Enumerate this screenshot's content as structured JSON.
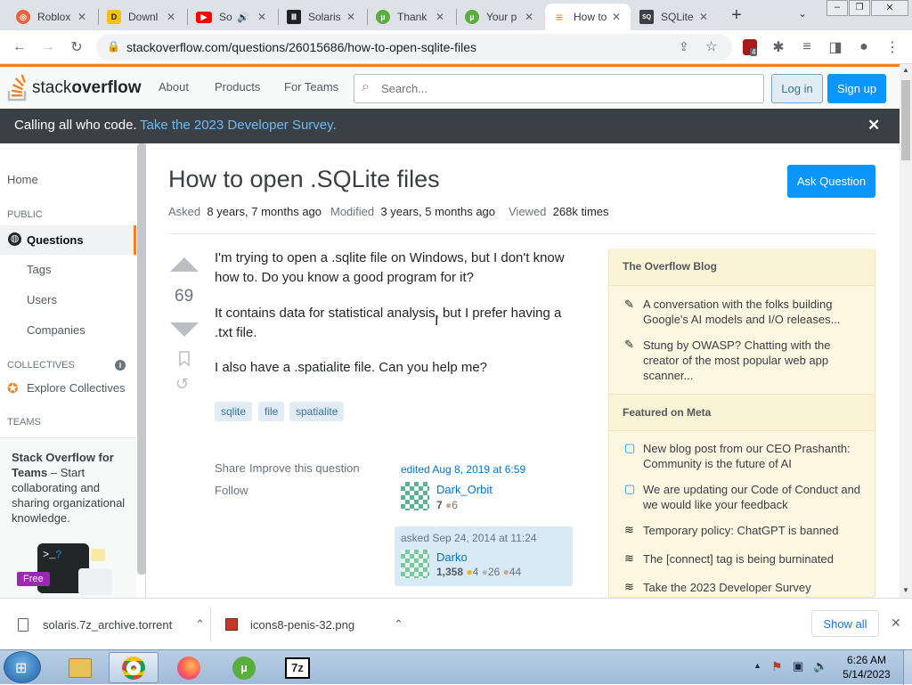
{
  "browser": {
    "tabs": [
      {
        "title": "Roblox",
        "icon": "roblox-icon",
        "color": "#e8623d"
      },
      {
        "title": "Downl",
        "icon": "download-site-icon",
        "color": "#f4c20d"
      },
      {
        "title": "So",
        "icon": "youtube-icon",
        "color": "#ff0000"
      },
      {
        "title": "Solaris",
        "icon": "museum-icon",
        "color": "#202124"
      },
      {
        "title": "Thank",
        "icon": "utorrent-icon",
        "color": "#5aae3c"
      },
      {
        "title": "Your p",
        "icon": "utorrent-icon",
        "color": "#5aae3c"
      },
      {
        "title": "How to",
        "icon": "stackoverflow-icon",
        "color": "#f48225"
      },
      {
        "title": "SQLite",
        "icon": "sqlite-icon",
        "color": "#3b4045"
      }
    ],
    "url": "stackoverflow.com/questions/26015686/how-to-open-sqlite-files",
    "extension_badge": "4"
  },
  "so": {
    "logo_plain": "stack",
    "logo_bold": "overflow",
    "nav": [
      "About",
      "Products",
      "For Teams"
    ],
    "search_placeholder": "Search...",
    "login": "Log in",
    "signup": "Sign up",
    "banner_text": "Calling all who code.",
    "banner_link": "Take the 2023 Developer Survey."
  },
  "leftnav": {
    "home": "Home",
    "public": "PUBLIC",
    "questions": "Questions",
    "tags": "Tags",
    "users": "Users",
    "companies": "Companies",
    "collectives": "COLLECTIVES",
    "explore": "Explore Collectives",
    "teams": "TEAMS",
    "teams_title": "Stack Overflow for Teams",
    "teams_dash": " – ",
    "teams_desc": "Start collaborating and sharing organizational knowledge.",
    "free": "Free"
  },
  "question": {
    "title": "How to open .SQLite files",
    "asked_label": "Asked",
    "asked_value": "8 years, 7 months ago",
    "modified_label": "Modified",
    "modified_value": "3 years, 5 months ago",
    "viewed_label": "Viewed",
    "viewed_value": "268k times",
    "ask_button": "Ask Question",
    "votes": "69",
    "body": [
      "I'm trying to open a .sqlite file on Windows, but I don't know how to. Do you know a good program for it?",
      "It contains data for statistical analysis, but I prefer having a .txt file.",
      "I also have a .spatialite file. Can you help me?"
    ],
    "tags": [
      "sqlite",
      "file",
      "spatialite"
    ],
    "share": "Share",
    "improve": "Improve this question",
    "follow": "Follow",
    "edited": "edited Aug 8, 2019 at 6:59",
    "editor": "Dark_Orbit",
    "editor_rep": "7",
    "editor_bronze": "6",
    "asked_card": "asked Sep 24, 2014 at 11:24",
    "asker": "Darko",
    "asker_rep": "1,358",
    "asker_gold": "4",
    "asker_silver": "26",
    "asker_bronze": "44"
  },
  "sidebar": {
    "blog_title": "The Overflow Blog",
    "blog_items": [
      "A conversation with the folks building Google's AI models and I/O releases...",
      "Stung by OWASP? Chatting with the creator of the most popular web app scanner..."
    ],
    "meta_title": "Featured on Meta",
    "meta_items": [
      "New blog post from our CEO Prashanth: Community is the future of AI",
      "We are updating our Code of Conduct and we would like your feedback",
      "Temporary policy: ChatGPT is banned",
      "The [connect] tag is being burninated",
      "Take the 2023 Developer Survey"
    ]
  },
  "downloads": {
    "files": [
      "solaris.7z_archive.torrent",
      "icons8-penis-32.png"
    ],
    "show_all": "Show all"
  },
  "taskbar": {
    "time": "6:26 AM",
    "date": "5/14/2023"
  }
}
